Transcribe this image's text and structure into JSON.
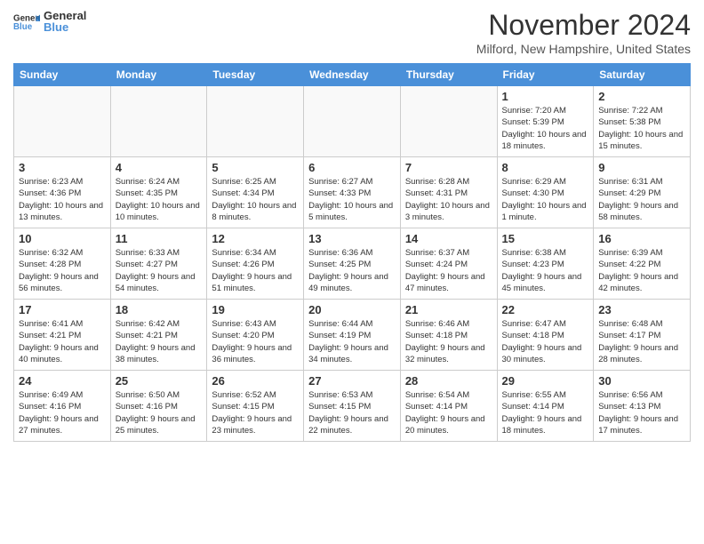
{
  "header": {
    "logo_general": "General",
    "logo_blue": "Blue",
    "month": "November 2024",
    "location": "Milford, New Hampshire, United States"
  },
  "days_of_week": [
    "Sunday",
    "Monday",
    "Tuesday",
    "Wednesday",
    "Thursday",
    "Friday",
    "Saturday"
  ],
  "weeks": [
    [
      {
        "day": "",
        "empty": true
      },
      {
        "day": "",
        "empty": true
      },
      {
        "day": "",
        "empty": true
      },
      {
        "day": "",
        "empty": true
      },
      {
        "day": "",
        "empty": true
      },
      {
        "day": "1",
        "info": "Sunrise: 7:20 AM\nSunset: 5:39 PM\nDaylight: 10 hours and 18 minutes."
      },
      {
        "day": "2",
        "info": "Sunrise: 7:22 AM\nSunset: 5:38 PM\nDaylight: 10 hours and 15 minutes."
      }
    ],
    [
      {
        "day": "3",
        "info": "Sunrise: 6:23 AM\nSunset: 4:36 PM\nDaylight: 10 hours and 13 minutes."
      },
      {
        "day": "4",
        "info": "Sunrise: 6:24 AM\nSunset: 4:35 PM\nDaylight: 10 hours and 10 minutes."
      },
      {
        "day": "5",
        "info": "Sunrise: 6:25 AM\nSunset: 4:34 PM\nDaylight: 10 hours and 8 minutes."
      },
      {
        "day": "6",
        "info": "Sunrise: 6:27 AM\nSunset: 4:33 PM\nDaylight: 10 hours and 5 minutes."
      },
      {
        "day": "7",
        "info": "Sunrise: 6:28 AM\nSunset: 4:31 PM\nDaylight: 10 hours and 3 minutes."
      },
      {
        "day": "8",
        "info": "Sunrise: 6:29 AM\nSunset: 4:30 PM\nDaylight: 10 hours and 1 minute."
      },
      {
        "day": "9",
        "info": "Sunrise: 6:31 AM\nSunset: 4:29 PM\nDaylight: 9 hours and 58 minutes."
      }
    ],
    [
      {
        "day": "10",
        "info": "Sunrise: 6:32 AM\nSunset: 4:28 PM\nDaylight: 9 hours and 56 minutes."
      },
      {
        "day": "11",
        "info": "Sunrise: 6:33 AM\nSunset: 4:27 PM\nDaylight: 9 hours and 54 minutes."
      },
      {
        "day": "12",
        "info": "Sunrise: 6:34 AM\nSunset: 4:26 PM\nDaylight: 9 hours and 51 minutes."
      },
      {
        "day": "13",
        "info": "Sunrise: 6:36 AM\nSunset: 4:25 PM\nDaylight: 9 hours and 49 minutes."
      },
      {
        "day": "14",
        "info": "Sunrise: 6:37 AM\nSunset: 4:24 PM\nDaylight: 9 hours and 47 minutes."
      },
      {
        "day": "15",
        "info": "Sunrise: 6:38 AM\nSunset: 4:23 PM\nDaylight: 9 hours and 45 minutes."
      },
      {
        "day": "16",
        "info": "Sunrise: 6:39 AM\nSunset: 4:22 PM\nDaylight: 9 hours and 42 minutes."
      }
    ],
    [
      {
        "day": "17",
        "info": "Sunrise: 6:41 AM\nSunset: 4:21 PM\nDaylight: 9 hours and 40 minutes."
      },
      {
        "day": "18",
        "info": "Sunrise: 6:42 AM\nSunset: 4:21 PM\nDaylight: 9 hours and 38 minutes."
      },
      {
        "day": "19",
        "info": "Sunrise: 6:43 AM\nSunset: 4:20 PM\nDaylight: 9 hours and 36 minutes."
      },
      {
        "day": "20",
        "info": "Sunrise: 6:44 AM\nSunset: 4:19 PM\nDaylight: 9 hours and 34 minutes."
      },
      {
        "day": "21",
        "info": "Sunrise: 6:46 AM\nSunset: 4:18 PM\nDaylight: 9 hours and 32 minutes."
      },
      {
        "day": "22",
        "info": "Sunrise: 6:47 AM\nSunset: 4:18 PM\nDaylight: 9 hours and 30 minutes."
      },
      {
        "day": "23",
        "info": "Sunrise: 6:48 AM\nSunset: 4:17 PM\nDaylight: 9 hours and 28 minutes."
      }
    ],
    [
      {
        "day": "24",
        "info": "Sunrise: 6:49 AM\nSunset: 4:16 PM\nDaylight: 9 hours and 27 minutes."
      },
      {
        "day": "25",
        "info": "Sunrise: 6:50 AM\nSunset: 4:16 PM\nDaylight: 9 hours and 25 minutes."
      },
      {
        "day": "26",
        "info": "Sunrise: 6:52 AM\nSunset: 4:15 PM\nDaylight: 9 hours and 23 minutes."
      },
      {
        "day": "27",
        "info": "Sunrise: 6:53 AM\nSunset: 4:15 PM\nDaylight: 9 hours and 22 minutes."
      },
      {
        "day": "28",
        "info": "Sunrise: 6:54 AM\nSunset: 4:14 PM\nDaylight: 9 hours and 20 minutes."
      },
      {
        "day": "29",
        "info": "Sunrise: 6:55 AM\nSunset: 4:14 PM\nDaylight: 9 hours and 18 minutes."
      },
      {
        "day": "30",
        "info": "Sunrise: 6:56 AM\nSunset: 4:13 PM\nDaylight: 9 hours and 17 minutes."
      }
    ]
  ]
}
